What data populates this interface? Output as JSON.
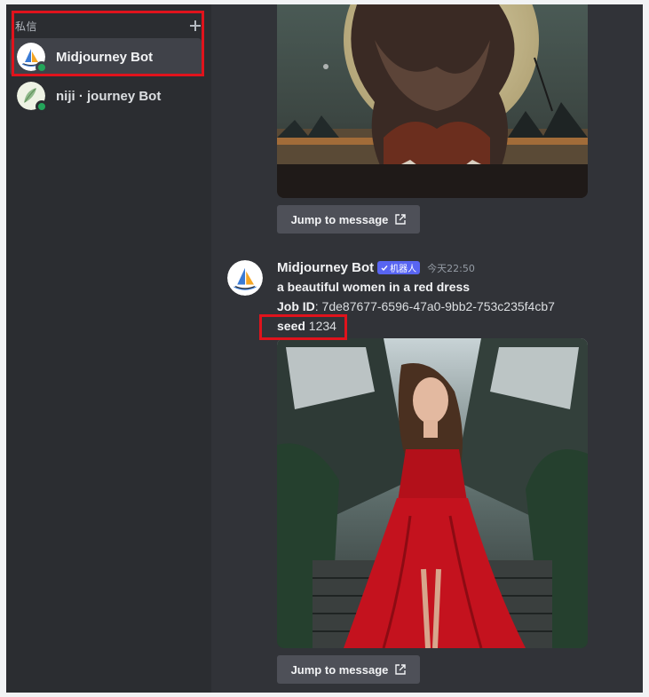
{
  "sidebar": {
    "section_label": "私信",
    "dms": [
      {
        "name": "Midjourney Bot",
        "status": "online",
        "selected": true
      },
      {
        "name": "niji · journey Bot",
        "status": "online",
        "selected": false
      }
    ]
  },
  "messages": {
    "previous": {
      "jump_label": "Jump to message"
    },
    "current": {
      "author": "Midjourney Bot",
      "bot_tag": "机器人",
      "timestamp": "今天22:50",
      "prompt": "a beautiful women in a red dress",
      "job_id_label": "Job ID",
      "job_id_value": ": 7de87677-6596-47a0-9bb2-753c235f4cb7",
      "seed_label": "seed",
      "seed_value": " 1234",
      "jump_label": "Jump to message"
    }
  },
  "colors": {
    "sidebar_bg": "#2b2d31",
    "chat_bg": "#313338",
    "selected_bg": "#404249",
    "highlight": "#e0131c",
    "bot_tag": "#5865f2",
    "online": "#23a55a"
  },
  "icons": [
    "plus-icon",
    "check-icon",
    "external-link-icon"
  ]
}
